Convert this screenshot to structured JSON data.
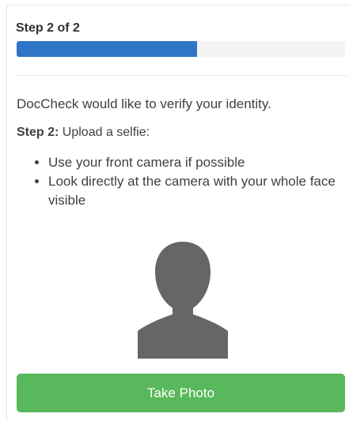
{
  "step": {
    "title": "Step 2 of 2",
    "progress_fraction": 0.55
  },
  "intro_text": "DocCheck would like to verify your identity.",
  "instruction": {
    "label": "Step 2:",
    "text": " Upload a selfie:"
  },
  "bullets": [
    "Use your front camera if possible",
    "Look directly at the camera with your whole face visible"
  ],
  "avatar": {
    "icon": "person-silhouette-icon",
    "color": "#666666"
  },
  "button": {
    "label": "Take Photo",
    "color": "#58b85b"
  },
  "progress_color": "#2f75c7"
}
